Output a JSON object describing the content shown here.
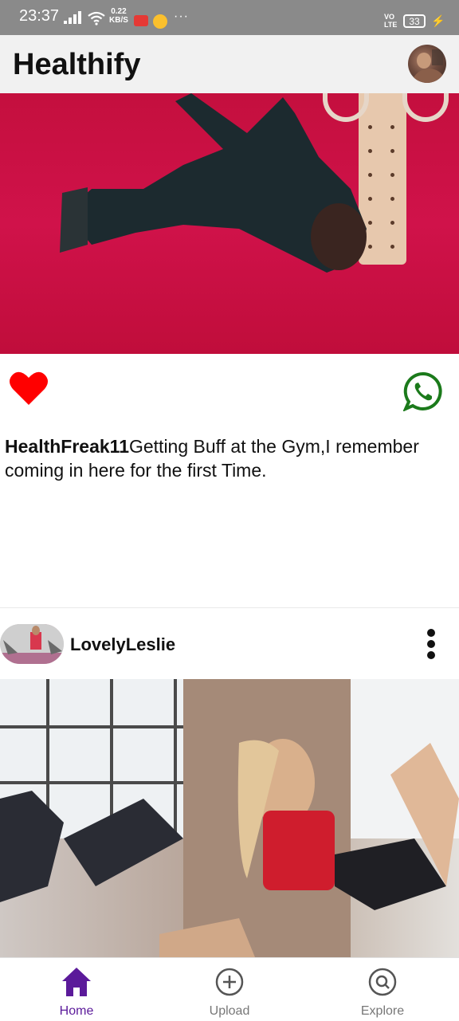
{
  "status_bar": {
    "time": "23:37",
    "net_speed_value": "0.22",
    "net_speed_unit": "KB/S",
    "more_dots": "···",
    "volte_top": "VO",
    "volte_bottom": "LTE",
    "battery": "33"
  },
  "app_bar": {
    "title": "Healthify",
    "avatar_icon": "profile-avatar"
  },
  "post1": {
    "image": "gym-climbing-photo",
    "like_icon": "heart-icon",
    "like_color": "#ff0000",
    "share_icon": "whatsapp-icon",
    "share_color": "#1b7a1b",
    "author": "HealthFreak11",
    "caption": "Getting Buff at the Gym,I remember coming in here for the first Time."
  },
  "post2": {
    "username": "LovelyLeslie",
    "avatar_icon": "user-avatar",
    "menu_icon": "more-vertical-icon",
    "image": "fitness-class-photo"
  },
  "bottom_nav": {
    "items": [
      {
        "label": "Home",
        "icon": "home-icon",
        "active": true
      },
      {
        "label": "Upload",
        "icon": "plus-circle-icon",
        "active": false
      },
      {
        "label": "Explore",
        "icon": "explore-icon",
        "active": false
      }
    ],
    "active_color": "#5b1a9a",
    "inactive_color": "#777777"
  }
}
